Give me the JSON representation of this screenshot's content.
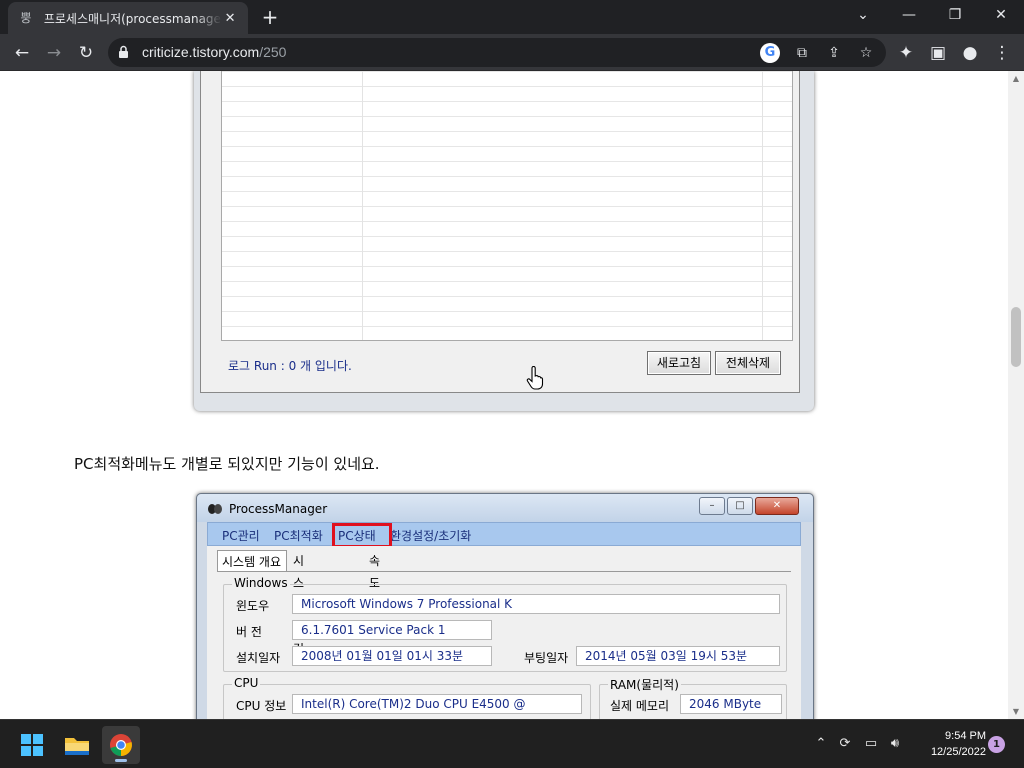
{
  "browser": {
    "tab_title": "프로세스매니저(processmanager",
    "tab_favicon": "뿡",
    "url_host": "criticize.tistory.com",
    "url_path": "/250",
    "icons": [
      "back-icon",
      "forward-icon",
      "reload-icon",
      "lock-icon",
      "google-icon",
      "translate-icon",
      "share-icon",
      "bookmark-star-icon",
      "extensions-icon",
      "side-panel-icon",
      "profile-icon",
      "menu-icon"
    ]
  },
  "shot1": {
    "log_text": "로그 Run : 0 개 입니다.",
    "refresh_label": "새로고침",
    "delete_all_label": "전체삭제"
  },
  "article": {
    "paragraph": "PC최적화메뉴도 개별로 되있지만 기능이 있네요."
  },
  "shot2": {
    "app_title": "ProcessManager",
    "menu": [
      "PC관리",
      "PC최적화",
      "PC상태",
      "환경설정/초기화"
    ],
    "highlight_color": "#e0101e",
    "tabs": [
      "시스템 개요",
      "시스템 점검",
      "속도 튜닝"
    ],
    "windows_group": {
      "legend": "Windows",
      "os_label": "윈도우",
      "os_value": "Microsoft Windows 7 Professional K",
      "version_label": "버 전",
      "version_value": "6.1.7601 Service Pack 1",
      "install_label": "설치일자",
      "install_value": "2008년 01월 01일 01시 33분",
      "boot_label": "부팅일자",
      "boot_value": "2014년 05월 03일 19시 53분"
    },
    "cpu_group": {
      "legend": "CPU",
      "info_label": "CPU 정보",
      "info_value": "Intel(R) Core(TM)2 Duo CPU     E4500  @"
    },
    "ram_group": {
      "legend": "RAM(물리적)",
      "real_label": "실제 메모리",
      "real_value": "2046 MByte"
    }
  },
  "taskbar": {
    "time": "9:54 PM",
    "date": "12/25/2022",
    "notification_count": "1",
    "apps": [
      "windows-start-icon",
      "file-explorer-icon",
      "chrome-icon"
    ]
  }
}
